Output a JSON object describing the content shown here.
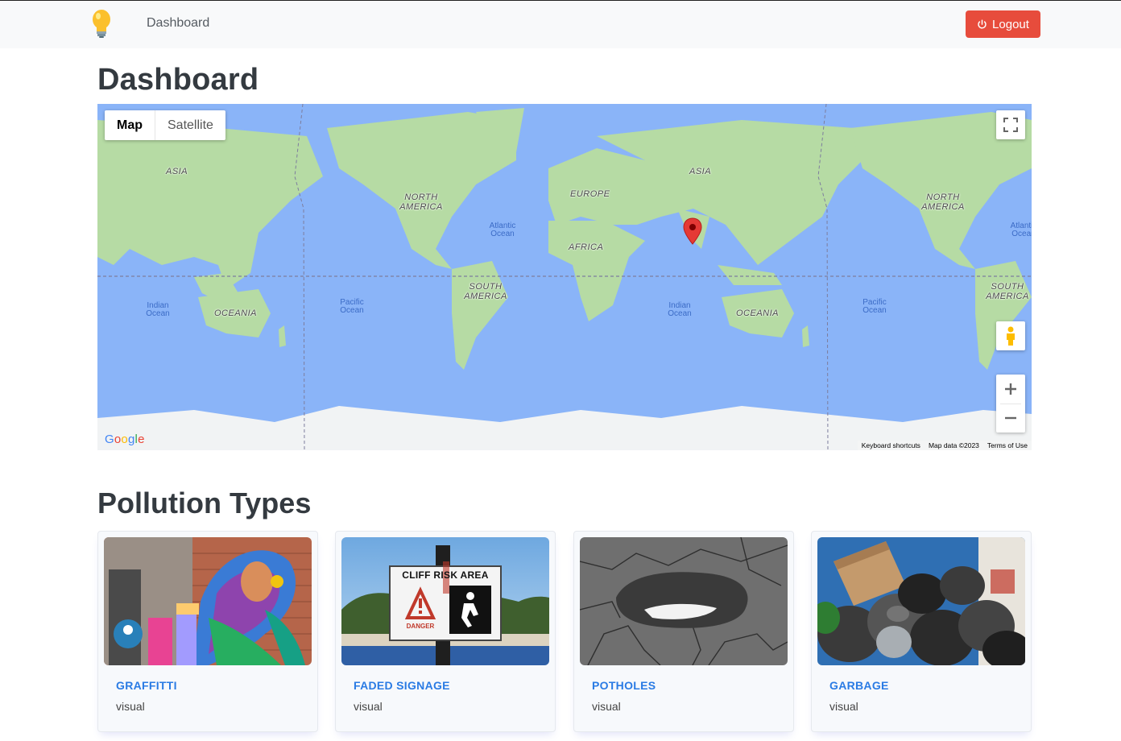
{
  "navbar": {
    "brand_icon": "lightbulb-icon",
    "link": "Dashboard",
    "logout_label": "Logout",
    "logout_icon": "power-icon",
    "logout_color": "#e74c3c"
  },
  "page_title": "Dashboard",
  "map": {
    "type_buttons": [
      "Map",
      "Satellite"
    ],
    "active_type": "Map",
    "continent_labels": [
      "ASIA",
      "NORTH AMERICA",
      "EUROPE",
      "ASIA",
      "NORTH AMERICA",
      "AFRICA",
      "SOUTH AMERICA",
      "SOUTH AMERICA",
      "OCEANIA",
      "OCEANIA"
    ],
    "ocean_labels": [
      "Atlantic Ocean",
      "Atlantic Ocean",
      "Indian Ocean",
      "Indian Ocean",
      "Pacific Ocean",
      "Pacific Ocean"
    ],
    "google_logo": "Google",
    "attribution": [
      "Keyboard shortcuts",
      "Map data ©2023",
      "Terms of Use"
    ],
    "water_color": "#8ab4f8",
    "land_color": "#b6dba4",
    "marker_color": "#e53935"
  },
  "section_title": "Pollution Types",
  "cards": [
    {
      "title": "GRAFFITTI",
      "category": "visual"
    },
    {
      "title": "FADED SIGNAGE",
      "category": "visual",
      "sign_text": "CLIFF RISK AREA",
      "sign_warning": "DANGER"
    },
    {
      "title": "POTHOLES",
      "category": "visual"
    },
    {
      "title": "GARBAGE",
      "category": "visual"
    }
  ]
}
